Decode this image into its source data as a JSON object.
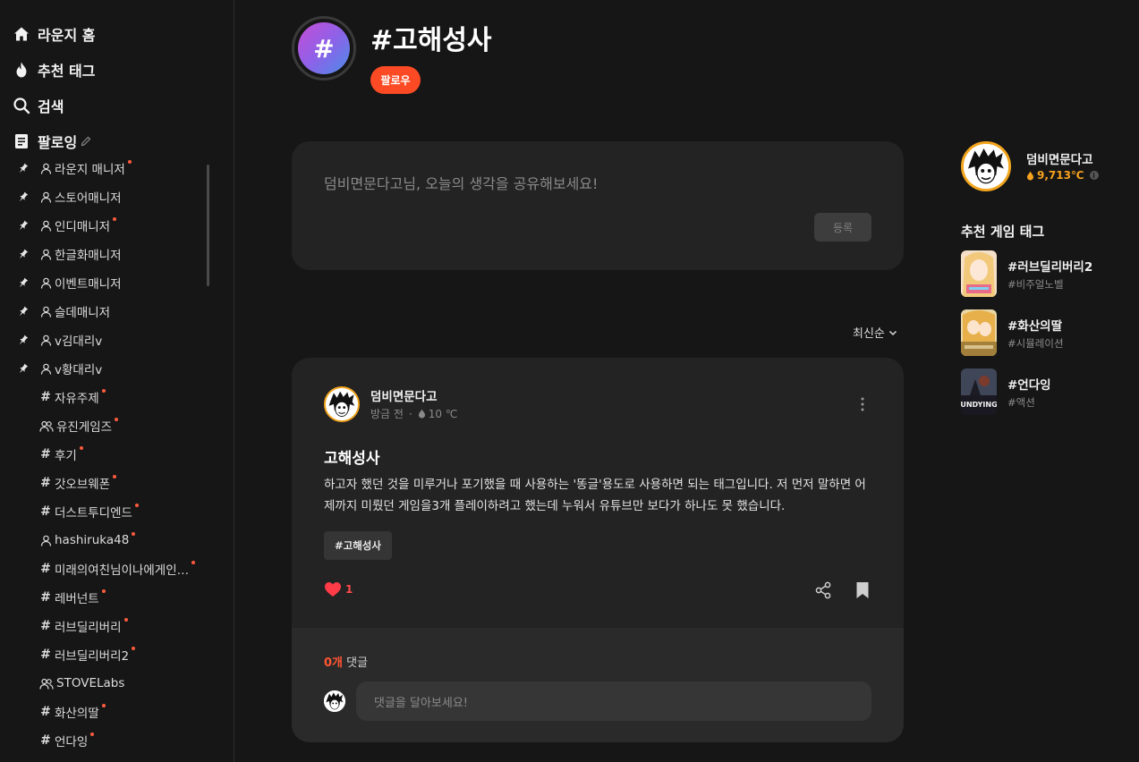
{
  "sidebar": {
    "main": [
      {
        "label": "라운지 홈",
        "icon": "home-icon"
      },
      {
        "label": "추천 태그",
        "icon": "fire-icon"
      },
      {
        "label": "검색",
        "icon": "search-icon"
      },
      {
        "label": "팔로잉",
        "icon": "document-icon"
      }
    ],
    "following": [
      {
        "label": "라운지 매니저",
        "pinned": true,
        "kind": "user",
        "new": true
      },
      {
        "label": "스토어매니저",
        "pinned": true,
        "kind": "user",
        "new": false
      },
      {
        "label": "인디매니저",
        "pinned": true,
        "kind": "user",
        "new": true
      },
      {
        "label": "한글화매니저",
        "pinned": true,
        "kind": "user",
        "new": false
      },
      {
        "label": "이벤트매니저",
        "pinned": true,
        "kind": "user",
        "new": false
      },
      {
        "label": "슬데매니저",
        "pinned": true,
        "kind": "user",
        "new": false
      },
      {
        "label": "v김대리v",
        "pinned": true,
        "kind": "user",
        "new": false
      },
      {
        "label": "v황대리v",
        "pinned": true,
        "kind": "user",
        "new": false
      },
      {
        "label": "자유주제",
        "pinned": false,
        "kind": "tag",
        "new": true
      },
      {
        "label": "유진게임즈",
        "pinned": false,
        "kind": "group",
        "new": true
      },
      {
        "label": "후기",
        "pinned": false,
        "kind": "tag",
        "new": true
      },
      {
        "label": "갓오브웨폰",
        "pinned": false,
        "kind": "tag",
        "new": true
      },
      {
        "label": "더스트투디엔드",
        "pinned": false,
        "kind": "tag",
        "new": true
      },
      {
        "label": "hashiruka48",
        "pinned": false,
        "kind": "user",
        "new": true
      },
      {
        "label": "미래의여친님이나에게인…",
        "pinned": false,
        "kind": "tag",
        "new": true
      },
      {
        "label": "레버넌트",
        "pinned": false,
        "kind": "tag",
        "new": true
      },
      {
        "label": "러브딜리버리",
        "pinned": false,
        "kind": "tag",
        "new": true
      },
      {
        "label": "러브딜리버리2",
        "pinned": false,
        "kind": "tag",
        "new": true
      },
      {
        "label": "STOVELabs",
        "pinned": false,
        "kind": "group",
        "new": false
      },
      {
        "label": "화산의딸",
        "pinned": false,
        "kind": "tag",
        "new": true
      },
      {
        "label": "언다잉",
        "pinned": false,
        "kind": "tag",
        "new": true
      }
    ]
  },
  "header": {
    "avatar_symbol": "#",
    "title": "#고해성사",
    "follow_label": "팔로우"
  },
  "composer": {
    "placeholder": "덤비면문다고님, 오늘의 생각을 공유해보세요!",
    "submit_label": "등록"
  },
  "sort": {
    "label": "최신순"
  },
  "post": {
    "author": "덤비면문다고",
    "time": "방금 전",
    "separator": "·",
    "temperature": "10 ℃",
    "title": "고해성사",
    "body": "하고자 했던 것을 미루거나 포기했을 때 사용하는 '똥글'용도로 사용하면 되는 태그입니다. 저 먼저 말하면 어제까지 미뤘던 게임을3개 플레이하려고 했는데 누워서 유튜브만 보다가 하나도 못 했습니다.",
    "tag": "#고해성사",
    "likes": "1",
    "comment_count": "0개",
    "comment_label": "댓글",
    "comment_placeholder": "댓글을 달아보세요!"
  },
  "profile": {
    "name": "덤비면문다고",
    "temperature": "9,713℃",
    "info_symbol": "i"
  },
  "recommend": {
    "heading": "추천 게임 태그",
    "games": [
      {
        "name": "#러브딜리버리2",
        "category": "#비주얼노벨"
      },
      {
        "name": "#화산의딸",
        "category": "#시뮬레이션"
      },
      {
        "name": "#언다잉",
        "category": "#액션",
        "thumb_text": "UNDYING"
      }
    ]
  },
  "colors": {
    "accent": "#fc4b24",
    "temperature": "#f7a21e",
    "like": "#ff4a4a",
    "card": "#232323",
    "background": "#161616"
  }
}
